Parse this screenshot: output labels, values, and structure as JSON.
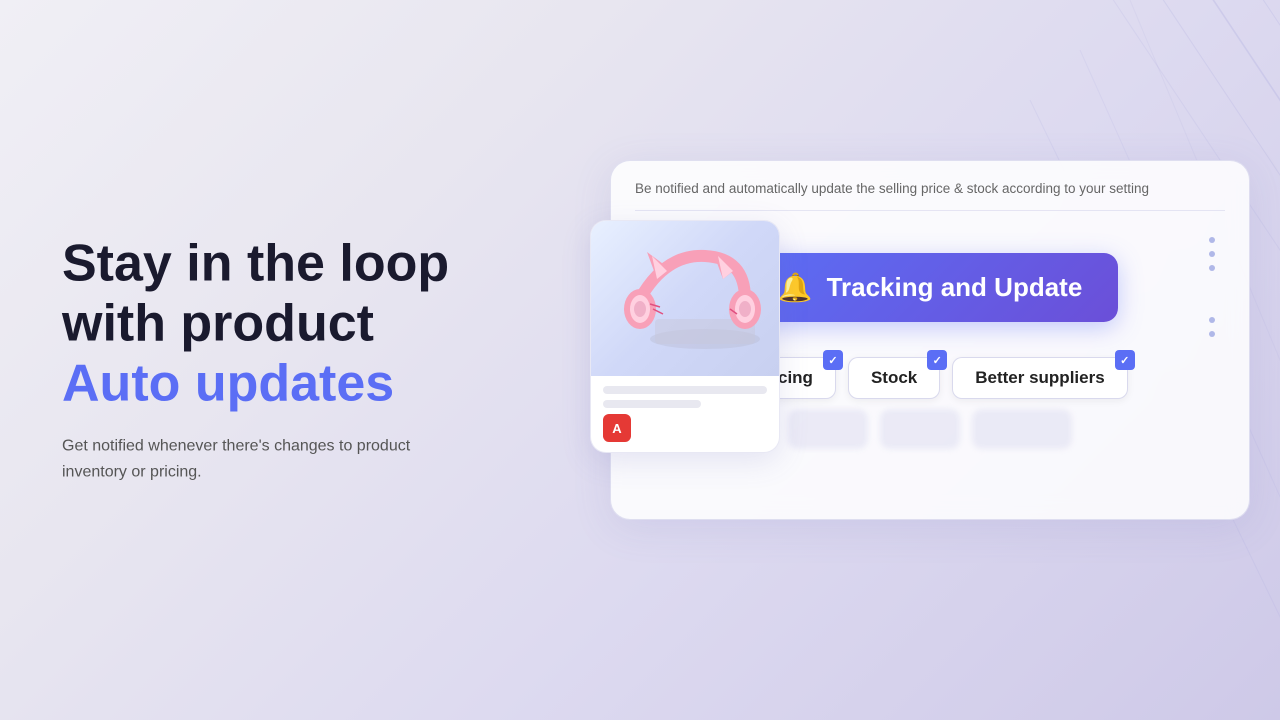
{
  "page": {
    "background": {
      "gradient_start": "#f0eff5",
      "gradient_end": "#cec9e8"
    }
  },
  "left": {
    "headline_line1": "Stay in the loop",
    "headline_line2": "with product",
    "headline_accent": "Auto updates",
    "subtext": "Get notified whenever there's changes to product inventory or pricing."
  },
  "card": {
    "description": "Be notified and automatically update the selling price & stock according to your setting",
    "tracking_button_label": "Tracking and Update",
    "bell_icon": "🔔",
    "tags": [
      {
        "label": "Pricing",
        "checked": true
      },
      {
        "label": "Stock",
        "checked": true
      },
      {
        "label": "Better suppliers",
        "checked": true
      }
    ]
  },
  "product": {
    "logo": "A",
    "alt": "Pink cat-ear headphones on laptop"
  }
}
